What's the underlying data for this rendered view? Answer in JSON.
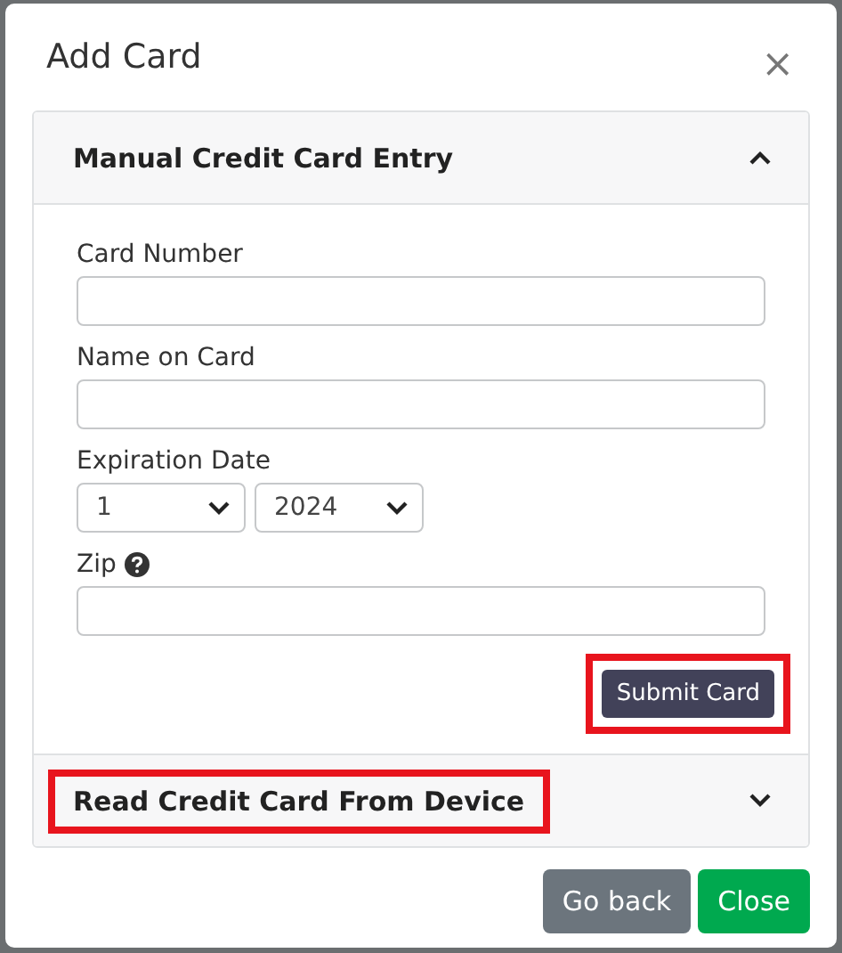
{
  "window": {
    "title": "Add Card",
    "close": "×"
  },
  "sections": [
    {
      "title": "Manual Credit Card Entry",
      "expanded": true,
      "highlighted": false,
      "fields": [
        {
          "kind": "text",
          "label": "Card Number"
        },
        {
          "kind": "text",
          "label": "Name on Card"
        },
        {
          "kind": "selects",
          "label": "Expiration Date",
          "selects": [
            {
              "value": "1"
            },
            {
              "value": "2024"
            }
          ]
        },
        {
          "kind": "text",
          "label": "Zip",
          "help": true
        }
      ],
      "submit": {
        "label": "Submit Card",
        "highlighted": true
      }
    },
    {
      "title": "Read Credit Card From Device",
      "expanded": false,
      "highlighted": true
    }
  ],
  "buttons": [
    {
      "label": "Go back",
      "kind": "secondary"
    },
    {
      "label": "Close",
      "kind": "success"
    }
  ]
}
